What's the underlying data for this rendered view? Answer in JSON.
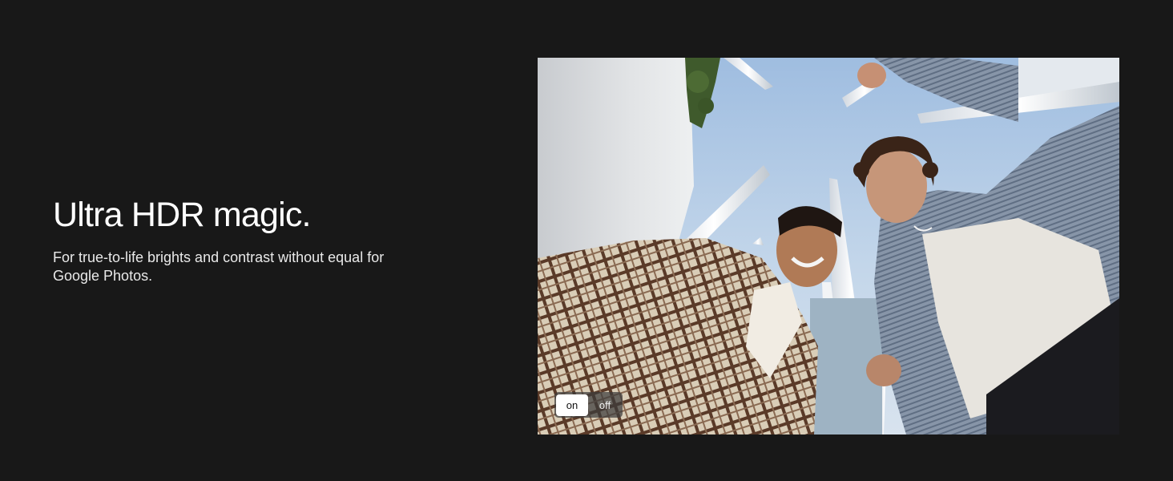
{
  "hero": {
    "headline": "Ultra HDR magic.",
    "subtext": "For true-to-life brights and contrast without equal for Google Photos."
  },
  "hdr_toggle": {
    "on_label": "on",
    "off_label": "off",
    "selected": "on"
  },
  "colors": {
    "page_background": "#181818",
    "text_primary": "#ffffff",
    "toggle_active_background": "#ffffff",
    "toggle_track": "#3c3c3c"
  }
}
